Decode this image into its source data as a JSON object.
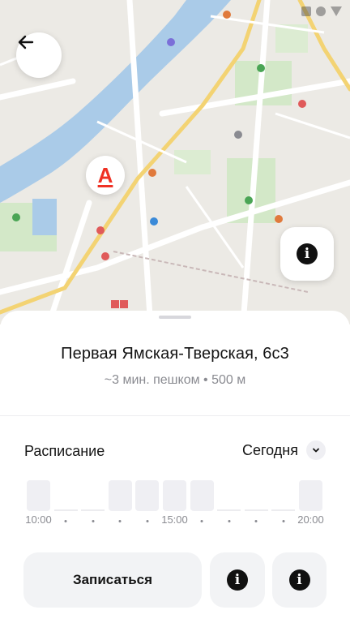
{
  "map": {
    "pin_letter": "А"
  },
  "office": {
    "address": "Первая Ямская-Тверская, 6с3",
    "distance": "~3 мин. пешком • 500 м"
  },
  "schedule": {
    "title": "Расписание",
    "day": "Сегодня",
    "load_levels": [
      1,
      0,
      0,
      1,
      1,
      1,
      1,
      0,
      0,
      0,
      1
    ],
    "tick_labels": [
      "10:00",
      "•",
      "•",
      "•",
      "•",
      "15:00",
      "•",
      "•",
      "•",
      "•",
      "20:00"
    ]
  },
  "actions": {
    "book_label": "Записаться"
  },
  "icons": {
    "back": "arrow-left-icon",
    "info": "info-icon",
    "chevron": "chevron-down-icon",
    "bank": "alfa-bank-logo-icon"
  },
  "colors": {
    "brand": "#ef3124",
    "button_bg": "#f2f3f5",
    "muted_text": "#8a8b91"
  }
}
